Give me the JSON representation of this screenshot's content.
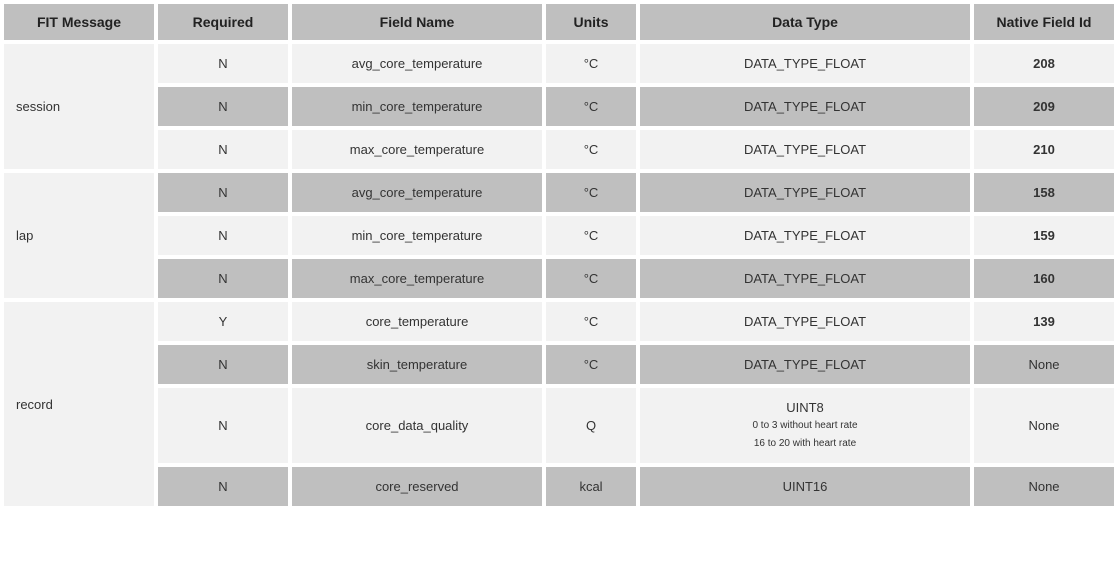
{
  "headers": {
    "fit_message": "FIT Message",
    "required": "Required",
    "field_name": "Field Name",
    "units": "Units",
    "data_type": "Data Type",
    "native_id": "Native Field Id"
  },
  "groups": [
    {
      "message": "session",
      "rows": [
        {
          "required": "N",
          "field_name": "avg_core_temperature",
          "units": "°C",
          "data_type": "DATA_TYPE_FLOAT",
          "native_id": "208",
          "id_bold": true
        },
        {
          "required": "N",
          "field_name": "min_core_temperature",
          "units": "°C",
          "data_type": "DATA_TYPE_FLOAT",
          "native_id": "209",
          "id_bold": true
        },
        {
          "required": "N",
          "field_name": "max_core_temperature",
          "units": "°C",
          "data_type": "DATA_TYPE_FLOAT",
          "native_id": "210",
          "id_bold": true
        }
      ]
    },
    {
      "message": "lap",
      "rows": [
        {
          "required": "N",
          "field_name": "avg_core_temperature",
          "units": "°C",
          "data_type": "DATA_TYPE_FLOAT",
          "native_id": "158",
          "id_bold": true
        },
        {
          "required": "N",
          "field_name": "min_core_temperature",
          "units": "°C",
          "data_type": "DATA_TYPE_FLOAT",
          "native_id": "159",
          "id_bold": true
        },
        {
          "required": "N",
          "field_name": "max_core_temperature",
          "units": "°C",
          "data_type": "DATA_TYPE_FLOAT",
          "native_id": "160",
          "id_bold": true
        }
      ]
    },
    {
      "message": "record",
      "rows": [
        {
          "required": "Y",
          "field_name": "core_temperature",
          "units": "°C",
          "data_type": "DATA_TYPE_FLOAT",
          "native_id": "139",
          "id_bold": true
        },
        {
          "required": "N",
          "field_name": "skin_temperature",
          "units": "°C",
          "data_type": "DATA_TYPE_FLOAT",
          "native_id": "None",
          "id_bold": false
        },
        {
          "required": "N",
          "field_name": "core_data_quality",
          "units": "Q",
          "data_type": "UINT8",
          "data_type_sub1": "0 to 3 without heart rate",
          "data_type_sub2": "16 to 20 with heart rate",
          "native_id": "None",
          "id_bold": false
        },
        {
          "required": "N",
          "field_name": "core_reserved",
          "units": "kcal",
          "data_type": "UINT16",
          "native_id": "None",
          "id_bold": false
        }
      ]
    }
  ]
}
